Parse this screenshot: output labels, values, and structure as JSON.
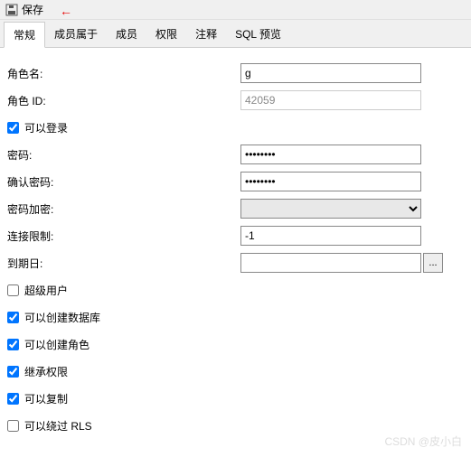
{
  "toolbar": {
    "save_label": "保存"
  },
  "annotation_arrow": "←",
  "tabs": {
    "general": "常规",
    "member_of": "成员属于",
    "members": "成员",
    "privileges": "权限",
    "comment": "注释",
    "sql_preview": "SQL 预览"
  },
  "form": {
    "role_name_label": "角色名:",
    "role_name_value": "g",
    "role_id_label": "角色 ID:",
    "role_id_value": "42059",
    "can_login_label": "可以登录",
    "password_label": "密码:",
    "password_value": "••••••••",
    "confirm_password_label": "确认密码:",
    "confirm_password_value": "••••••••",
    "encryption_label": "密码加密:",
    "connection_limit_label": "连接限制:",
    "connection_limit_value": "-1",
    "expiration_label": "到期日:",
    "expiration_value": "",
    "date_btn": "...",
    "superuser_label": "超级用户",
    "can_create_db_label": "可以创建数据库",
    "can_create_role_label": "可以创建角色",
    "inherit_label": "继承权限",
    "can_replicate_label": "可以复制",
    "bypass_rls_label": "可以绕过 RLS"
  },
  "watermark": "CSDN @皮小白"
}
